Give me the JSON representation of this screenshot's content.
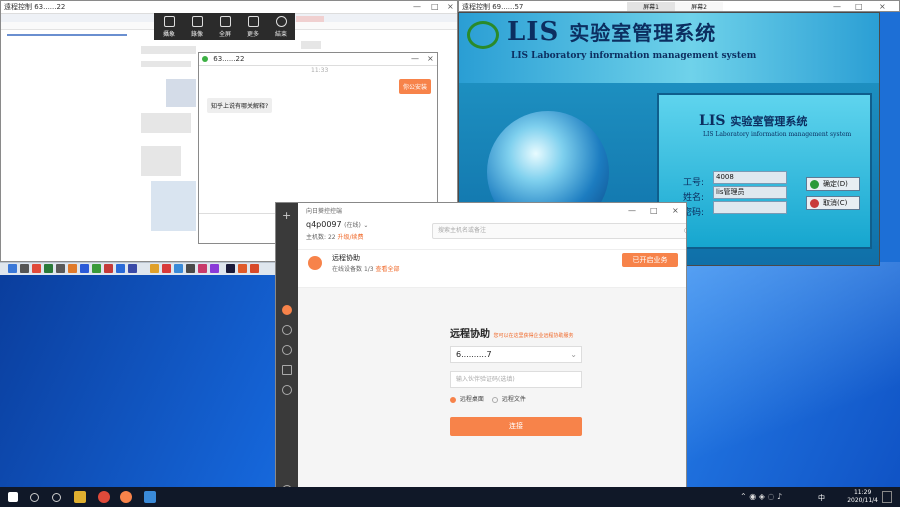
{
  "remote_left": {
    "title": "遠程控制 63......22"
  },
  "float_toolbar": {
    "items": [
      "攝象",
      "錄像",
      "全屏",
      "更多",
      "結束"
    ]
  },
  "chat": {
    "title": "63......22",
    "time": "11:33",
    "sent": "你公安装",
    "received": "知乎上说有哪关解释?"
  },
  "remote_right": {
    "title": "遠程控制 69......57",
    "tabs": [
      "屏幕1",
      "屏幕2"
    ]
  },
  "lis": {
    "title_cn": "实验室管理系统",
    "brand": "LIS",
    "title_en": "LIS Laboratory information management system",
    "panel_cn": "实验室管理系统",
    "panel_en": "LIS Laboratory information management system",
    "labels": [
      "工号:",
      "姓名:",
      "密码:"
    ],
    "job_no": "4008",
    "name_value": "lis管理员",
    "ok_label": "确定(D)",
    "cancel_label": "取消(C)"
  },
  "assist": {
    "title": "向日葵控控端",
    "id_label": "q4p0097",
    "id_suffix": "(在线)",
    "host_label": "主机数:",
    "host_value": "22",
    "upgrade": "升级/续费",
    "search_placeholder": "搜索主机名或备注",
    "partner_name": "远程协助",
    "partner_status": "在线设备数",
    "partner_count": "1/3",
    "partner_link": "查看全部",
    "partner_button": "已开启业务",
    "heading": "远程协助",
    "heading_note": "您可以在这里获得企业远程协助服务",
    "select_value": "6..........7",
    "input_placeholder": "输入伙伴验证码(选填)",
    "radio1": "远程桌面",
    "radio2": "远程文件",
    "submit": "连接"
  },
  "taskbar": {
    "time": "11:29",
    "date": "2020/11/4",
    "ime": "中"
  },
  "colors": {
    "accent_orange": "#f7834a",
    "lis_navy": "#0c2e60",
    "desktop_blue": "#1565d8"
  }
}
